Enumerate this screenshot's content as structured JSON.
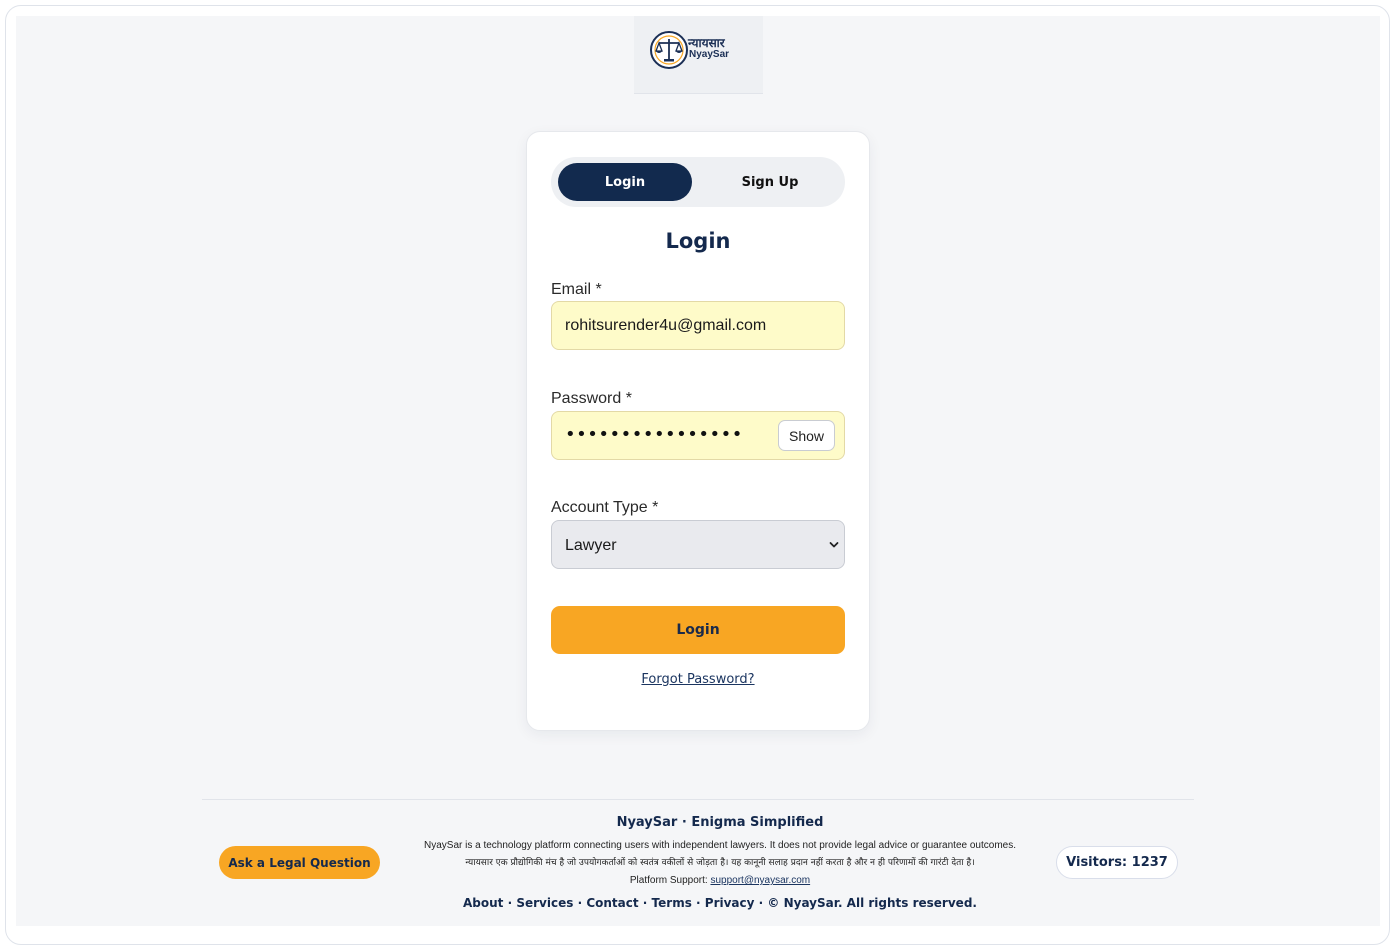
{
  "logo": {
    "hindi": "न्यायसार",
    "english": "NyaySar"
  },
  "tabs": {
    "login": "Login",
    "signup": "Sign Up"
  },
  "form": {
    "heading": "Login",
    "email_label": "Email *",
    "email_value": "rohitsurender4u@gmail.com",
    "password_label": "Password *",
    "password_mask": "••••••••••••••••",
    "show_label": "Show",
    "account_type_label": "Account Type *",
    "account_type_value": "Lawyer",
    "submit_label": "Login",
    "forgot_label": "Forgot Password?"
  },
  "footer": {
    "ask_button": "Ask a Legal Question",
    "brand": "NyaySar · Enigma Simplified",
    "disclaimer_en": "NyaySar is a technology platform connecting users with independent lawyers. It does not provide legal advice or guarantee outcomes.",
    "disclaimer_hi": "न्यायसार एक प्रौद्योगिकी मंच है जो उपयोगकर्ताओं को स्वतंत्र वकीलों से जोड़ता है। यह कानूनी सलाह प्रदान नहीं करता है और न ही परिणामों की गारंटी देता है।",
    "support_prefix": "Platform Support:",
    "support_email": "support@nyaysar.com",
    "links": [
      "About",
      "Services",
      "Contact",
      "Terms",
      "Privacy"
    ],
    "separator": "·",
    "copyright": "© NyaySar. All rights reserved.",
    "visitors": "Visitors: 1237"
  },
  "colors": {
    "navy": "#122a4e",
    "accent": "#f8a623",
    "field_bg": "#fefbc9"
  },
  "icons": {
    "logo": "scales-of-justice-seal-icon",
    "select": "chevron-down-icon"
  }
}
